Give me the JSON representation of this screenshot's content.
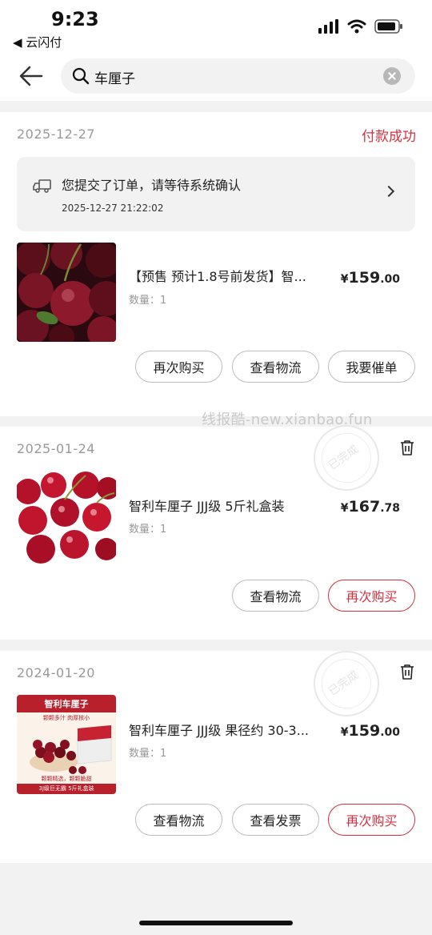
{
  "status_bar": {
    "time": "9:23",
    "back_app": "◀ 云闪付"
  },
  "search": {
    "query": "车厘子"
  },
  "orders": [
    {
      "date": "2025-12-27",
      "status": "付款成功",
      "notice": {
        "title": "您提交了订单，请等待系统确认",
        "time": "2025-12-27 21:22:02"
      },
      "product": {
        "name": "【预售 预计1.8号前发货】智...",
        "qty": "数量：1",
        "price_symbol": "¥",
        "price_int": "159",
        "price_dec": ".00"
      },
      "buttons": [
        "再次购买",
        "查看物流",
        "我要催单"
      ]
    },
    {
      "date": "2025-01-24",
      "stamp": "已完成",
      "product": {
        "name": "智利车厘子 JJJ级 5斤礼盒装",
        "qty": "数量：1",
        "price_symbol": "¥",
        "price_int": "167",
        "price_dec": ".78"
      },
      "buttons": [
        "查看物流",
        "再次购买"
      ]
    },
    {
      "date": "2024-01-20",
      "stamp": "已完成",
      "product": {
        "name": "智利车厘子 JJJ级 果径约 30-3...",
        "qty": "数量：1",
        "price_symbol": "¥",
        "price_int": "159",
        "price_dec": ".00",
        "image_text": {
          "top": "智利车厘子",
          "sub": "颗颗多汁 肉厚核小",
          "bottom1": "颗颗精选，颗颗脆甜",
          "bottom2": "3J级巨无霸 5斤礼盒装"
        }
      },
      "buttons": [
        "查看物流",
        "查看发票",
        "再次购买"
      ]
    }
  ],
  "watermark": "线报酷-new.xianbao.fun",
  "colors": {
    "accent": "#d23240",
    "muted": "#999999",
    "background": "#f2f2f2"
  }
}
